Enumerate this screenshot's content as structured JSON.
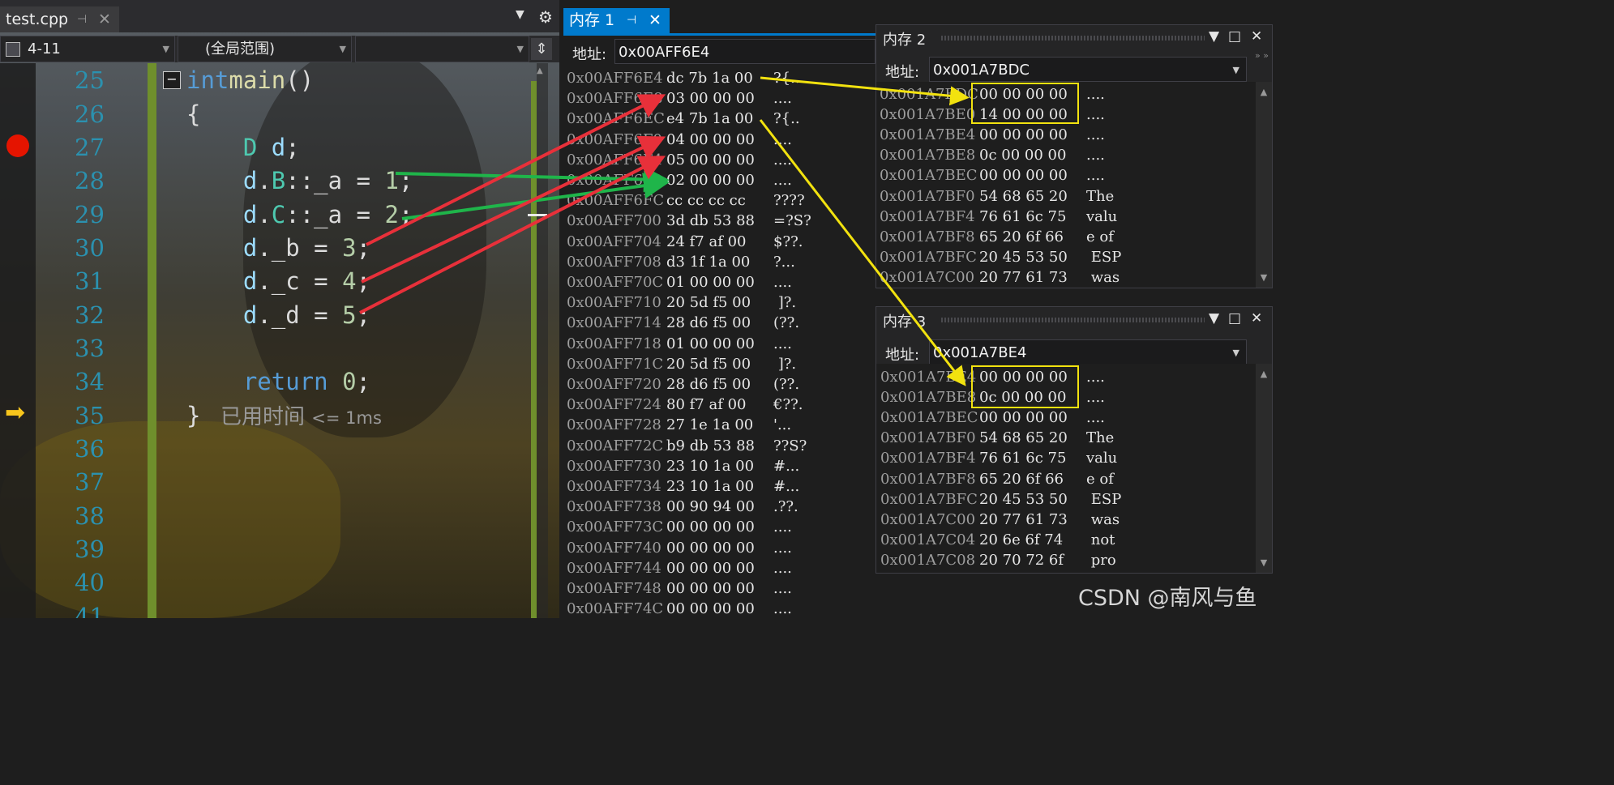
{
  "editor": {
    "file_tab": "test.cpp",
    "pin_icon": "pin-icon",
    "nav": {
      "project": "4-11",
      "scope": "(全局范围)",
      "member": ""
    },
    "elapsed": {
      "label": "已用时间",
      "value": "<= 1ms"
    },
    "lines": [
      {
        "n": "25"
      },
      {
        "n": "26"
      },
      {
        "n": "27"
      },
      {
        "n": "28"
      },
      {
        "n": "29"
      },
      {
        "n": "30"
      },
      {
        "n": "31"
      },
      {
        "n": "32"
      },
      {
        "n": "33"
      },
      {
        "n": "34"
      },
      {
        "n": "35"
      },
      {
        "n": "36"
      },
      {
        "n": "37"
      },
      {
        "n": "38"
      },
      {
        "n": "39"
      },
      {
        "n": "40"
      },
      {
        "n": "41"
      }
    ]
  },
  "mem1": {
    "title": "内存 1",
    "addr_label": "地址:",
    "addr_value": "0x00AFF6E4",
    "rows": [
      [
        "0x00AFF6E4",
        "dc 7b 1a 00",
        "?{.."
      ],
      [
        "0x00AFF6E8",
        "03 00 00 00",
        "...."
      ],
      [
        "0x00AFF6EC",
        "e4 7b 1a 00",
        "?{.."
      ],
      [
        "0x00AFF6F0",
        "04 00 00 00",
        "...."
      ],
      [
        "0x00AFF6F4",
        "05 00 00 00",
        "...."
      ],
      [
        "0x00AFF6F8",
        "02 00 00 00",
        "...."
      ],
      [
        "0x00AFF6FC",
        "cc cc cc cc",
        "????"
      ],
      [
        "0x00AFF700",
        "3d db 53 88",
        "=?S?"
      ],
      [
        "0x00AFF704",
        "24 f7 af 00",
        "$??."
      ],
      [
        "0x00AFF708",
        "d3 1f 1a 00",
        "?..."
      ],
      [
        "0x00AFF70C",
        "01 00 00 00",
        "...."
      ],
      [
        "0x00AFF710",
        "20 5d f5 00",
        " ]?."
      ],
      [
        "0x00AFF714",
        "28 d6 f5 00",
        "(??."
      ],
      [
        "0x00AFF718",
        "01 00 00 00",
        "...."
      ],
      [
        "0x00AFF71C",
        "20 5d f5 00",
        " ]?."
      ],
      [
        "0x00AFF720",
        "28 d6 f5 00",
        "(??."
      ],
      [
        "0x00AFF724",
        "80 f7 af 00",
        "€??."
      ],
      [
        "0x00AFF728",
        "27 1e 1a 00",
        "'..."
      ],
      [
        "0x00AFF72C",
        "b9 db 53 88",
        "??S?"
      ],
      [
        "0x00AFF730",
        "23 10 1a 00",
        "#..."
      ],
      [
        "0x00AFF734",
        "23 10 1a 00",
        "#..."
      ],
      [
        "0x00AFF738",
        "00 90 94 00",
        ".??."
      ],
      [
        "0x00AFF73C",
        "00 00 00 00",
        "...."
      ],
      [
        "0x00AFF740",
        "00 00 00 00",
        "...."
      ],
      [
        "0x00AFF744",
        "00 00 00 00",
        "...."
      ],
      [
        "0x00AFF748",
        "00 00 00 00",
        "...."
      ],
      [
        "0x00AFF74C",
        "00 00 00 00",
        "...."
      ]
    ]
  },
  "mem2": {
    "title": "内存 2",
    "addr_label": "地址:",
    "addr_value": "0x001A7BDC",
    "rows": [
      [
        "0x001A7BDC",
        "00 00 00 00",
        "...."
      ],
      [
        "0x001A7BE0",
        "14 00 00 00",
        "...."
      ],
      [
        "0x001A7BE4",
        "00 00 00 00",
        "...."
      ],
      [
        "0x001A7BE8",
        "0c 00 00 00",
        "...."
      ],
      [
        "0x001A7BEC",
        "00 00 00 00",
        "...."
      ],
      [
        "0x001A7BF0",
        "54 68 65 20",
        "The "
      ],
      [
        "0x001A7BF4",
        "76 61 6c 75",
        "valu"
      ],
      [
        "0x001A7BF8",
        "65 20 6f 66",
        "e of"
      ],
      [
        "0x001A7BFC",
        "20 45 53 50",
        " ESP"
      ],
      [
        "0x001A7C00",
        "20 77 61 73",
        " was"
      ]
    ]
  },
  "mem3": {
    "title": "内存 3",
    "addr_label": "地址:",
    "addr_value": "0x001A7BE4",
    "rows": [
      [
        "0x001A7BE4",
        "00 00 00 00",
        "...."
      ],
      [
        "0x001A7BE8",
        "0c 00 00 00",
        "...."
      ],
      [
        "0x001A7BEC",
        "00 00 00 00",
        "...."
      ],
      [
        "0x001A7BF0",
        "54 68 65 20",
        "The "
      ],
      [
        "0x001A7BF4",
        "76 61 6c 75",
        "valu"
      ],
      [
        "0x001A7BF8",
        "65 20 6f 66",
        "e of"
      ],
      [
        "0x001A7BFC",
        "20 45 53 50",
        " ESP"
      ],
      [
        "0x001A7C00",
        "20 77 61 73",
        " was"
      ],
      [
        "0x001A7C04",
        "20 6e 6f 74",
        " not"
      ],
      [
        "0x001A7C08",
        "20 70 72 6f",
        " pro"
      ]
    ]
  },
  "watermark": "CSDN @南风与鱼",
  "colors": {
    "accent": "#007acc",
    "red_arrow": "#e8303a",
    "green_arrow": "#1fb54a",
    "yellow_arrow": "#f2e20f",
    "breakpoint": "#e51400"
  }
}
